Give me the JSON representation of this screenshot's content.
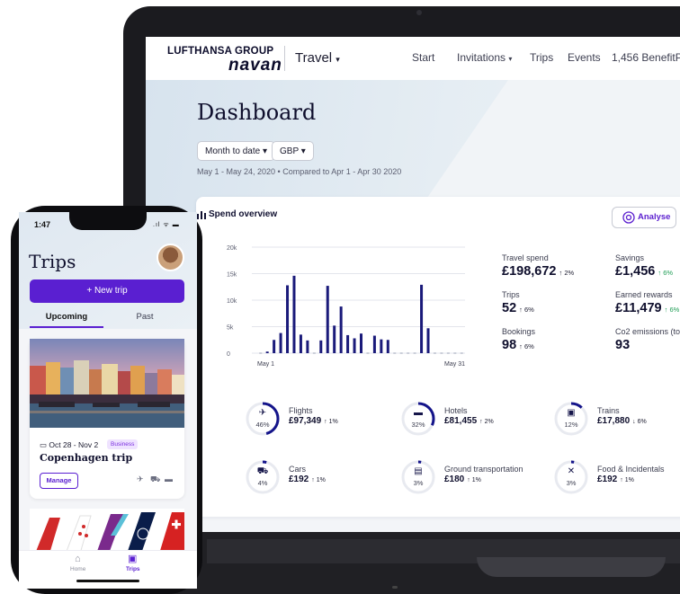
{
  "laptop": {
    "brand": {
      "group": "LUFTHANSA GROUP",
      "product": "navan"
    },
    "nav": {
      "app_menu": "Travel",
      "links": [
        "Start",
        "Invitations",
        "Trips",
        "Events",
        "1,456 BenefitPoi"
      ]
    },
    "dashboard": {
      "title": "Dashboard",
      "filter_period": "Month to date",
      "filter_currency": "GBP",
      "date_range": "May 1 - May 24, 2020  •  Compared to Apr 1 - Apr 30 2020"
    },
    "spend": {
      "title": "Spend overview",
      "analyse_label": "Analyse",
      "stats": {
        "travel_spend": {
          "label": "Travel spend",
          "value": "£198,672",
          "delta": "↑ 2%"
        },
        "savings": {
          "label": "Savings",
          "value": "£1,456",
          "delta": "↑ 6%"
        },
        "trips": {
          "label": "Trips",
          "value": "52",
          "delta": "↑ 6%"
        },
        "earned_rewards": {
          "label": "Earned rewards",
          "value": "£11,479",
          "delta": "↑ 6%"
        },
        "bookings": {
          "label": "Bookings",
          "value": "98",
          "delta": "↑ 6%"
        },
        "co2": {
          "label": "Co2 emissions (to",
          "value": "93"
        }
      },
      "categories": [
        {
          "name": "Flights",
          "value": "£97,349",
          "delta": "↑ 1%",
          "pct": "46%",
          "share": 46,
          "icon": "plane-icon",
          "glyph": "✈"
        },
        {
          "name": "Hotels",
          "value": "£81,455",
          "delta": "↑ 2%",
          "pct": "32%",
          "share": 32,
          "icon": "bed-icon",
          "glyph": "▬"
        },
        {
          "name": "Trains",
          "value": "£17,880",
          "delta": "↓ 6%",
          "pct": "12%",
          "share": 12,
          "icon": "train-icon",
          "glyph": "▣"
        },
        {
          "name": "Cars",
          "value": "£192",
          "delta": "↑ 1%",
          "pct": "4%",
          "share": 4,
          "icon": "car-icon",
          "glyph": "⛟"
        },
        {
          "name": "Ground transportation",
          "value": "£180",
          "delta": "↑ 1%",
          "pct": "3%",
          "share": 3,
          "icon": "bus-icon",
          "glyph": "▤"
        },
        {
          "name": "Food & Incidentals",
          "value": "£192",
          "delta": "↑ 1%",
          "pct": "3%",
          "share": 3,
          "icon": "cutlery-icon",
          "glyph": "✕"
        }
      ]
    }
  },
  "chart_data": {
    "type": "bar",
    "title": "Spend overview",
    "x_start_label": "May 1",
    "x_end_label": "May 31",
    "ylim": [
      0,
      20000
    ],
    "yticks": [
      0,
      5000,
      10000,
      15000,
      20000
    ],
    "ytick_labels": [
      "0",
      "5k",
      "10k",
      "15k",
      "20k"
    ],
    "values": [
      0,
      300,
      2500,
      3800,
      12800,
      14600,
      3500,
      2400,
      0,
      2400,
      12700,
      5200,
      8800,
      3400,
      2800,
      3700,
      0,
      3300,
      2600,
      2500,
      0,
      0,
      0,
      0,
      12900,
      4700,
      0,
      0,
      0,
      0,
      0
    ],
    "grid": true,
    "color": "#1a1a7a"
  },
  "phone": {
    "time": "1:47",
    "status": ".ıl ᯤ ▬",
    "title": "Trips",
    "new_trip_label": "+  New trip",
    "tabs": {
      "upcoming": "Upcoming",
      "past": "Past"
    },
    "trip": {
      "dates": "Oct 28 - Nov 2",
      "badge": "Business",
      "name": "Copenhagen trip",
      "manage_label": "Manage"
    },
    "bottom_nav": {
      "home": "Home",
      "trips": "Trips"
    }
  }
}
